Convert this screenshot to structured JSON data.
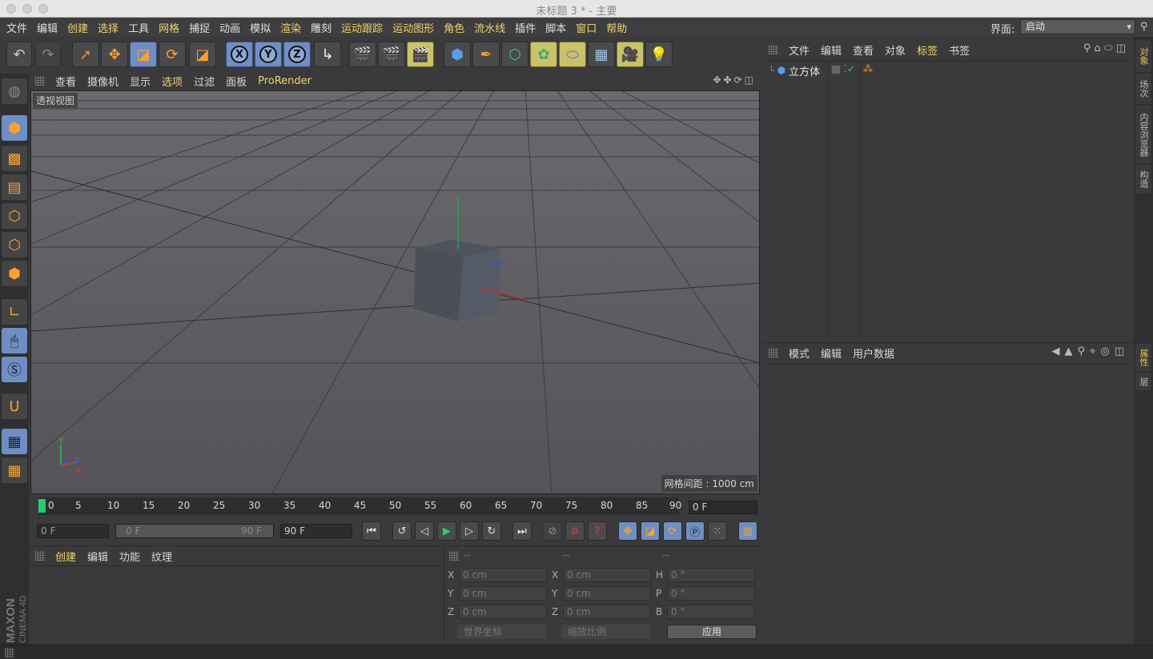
{
  "window": {
    "title": "未标题 3 * - 主要"
  },
  "menubar": {
    "items": [
      "文件",
      "编辑",
      "创建",
      "选择",
      "工具",
      "网格",
      "捕捉",
      "动画",
      "模拟",
      "渲染",
      "雕刻",
      "运动跟踪",
      "运动图形",
      "角色",
      "流水线",
      "插件",
      "脚本",
      "窗口",
      "帮助"
    ],
    "highlighted": [
      2,
      3,
      5,
      9,
      11,
      12,
      13,
      14,
      17,
      18
    ]
  },
  "layout": {
    "label": "界面:",
    "value": "启动"
  },
  "viewport": {
    "menu": [
      "查看",
      "摄像机",
      "显示",
      "选项",
      "过滤",
      "面板",
      "ProRender"
    ],
    "highlighted_index": 3,
    "view_label": "透视视图",
    "grid_label": "网格间距 : 1000 cm"
  },
  "timeline": {
    "ticks": [
      "0",
      "5",
      "10",
      "15",
      "20",
      "25",
      "30",
      "35",
      "40",
      "45",
      "50",
      "55",
      "60",
      "65",
      "70",
      "75",
      "80",
      "85",
      "90"
    ],
    "current_frame": "0 F"
  },
  "transport": {
    "start": "0 F",
    "range_start": "0 F",
    "range_end": "90 F",
    "end": "90 F"
  },
  "material_panel": {
    "tabs": [
      "创建",
      "编辑",
      "功能",
      "纹理"
    ]
  },
  "coord_panel": {
    "headers": [
      "--",
      "--",
      "--"
    ],
    "pos": [
      {
        "axis": "X",
        "value": "0 cm"
      },
      {
        "axis": "Y",
        "value": "0 cm"
      },
      {
        "axis": "Z",
        "value": "0 cm"
      }
    ],
    "size": [
      {
        "axis": "X",
        "value": "0 cm"
      },
      {
        "axis": "Y",
        "value": "0 cm"
      },
      {
        "axis": "Z",
        "value": "0 cm"
      }
    ],
    "rot": [
      {
        "axis": "H",
        "value": "0 °"
      },
      {
        "axis": "P",
        "value": "0 °"
      },
      {
        "axis": "B",
        "value": "0 °"
      }
    ],
    "coord_system": "世界坐标",
    "scale_mode": "缩放比例",
    "apply": "应用"
  },
  "object_panel": {
    "menu": [
      "文件",
      "编辑",
      "查看",
      "对象",
      "标签",
      "书签"
    ],
    "highlighted_index": 4,
    "objects": [
      {
        "name": "立方体"
      }
    ]
  },
  "attr_panel": {
    "menu": [
      "模式",
      "编辑",
      "用户数据"
    ]
  },
  "right_tabs": [
    "对象",
    "场次",
    "内容浏览器",
    "构造",
    "属性",
    "层"
  ],
  "brand": {
    "line1": "MAXON",
    "line2": "CINEMA 4D"
  },
  "colors": {
    "accent_blue": "#6f8fc4",
    "highlight_text": "#f0d36a",
    "active_tab": "#f0c050",
    "frame_marker": "#21d06b"
  }
}
